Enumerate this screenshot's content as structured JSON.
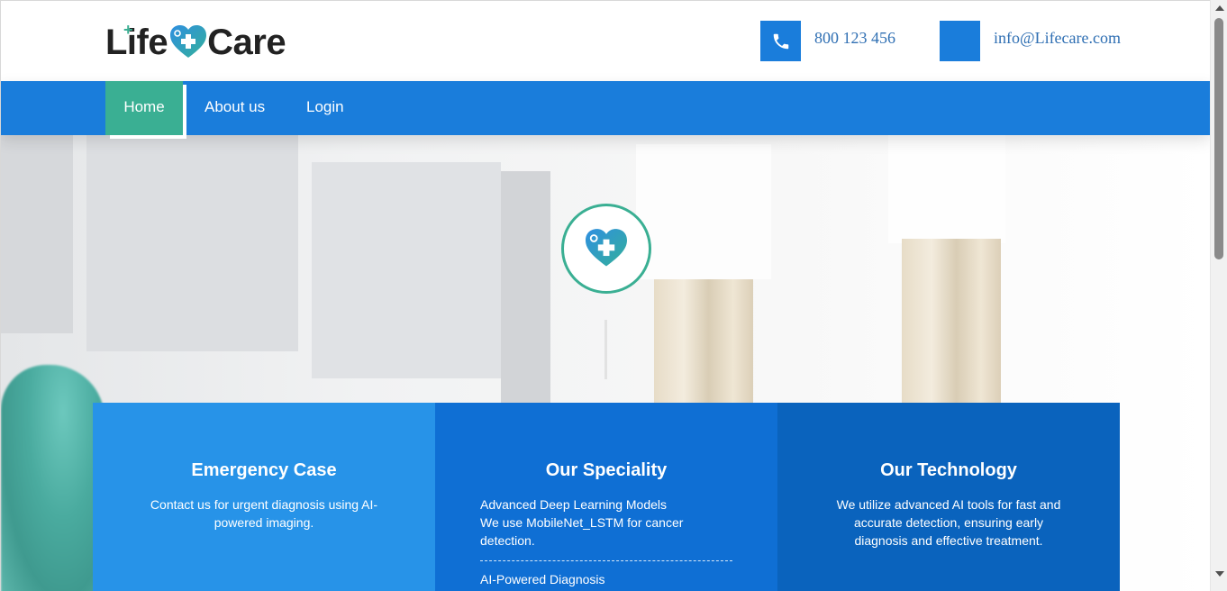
{
  "logo": {
    "left": "Life",
    "right": "Care",
    "plus": "+"
  },
  "contact": {
    "phone": "800 123 456",
    "email": "info@Lifecare.com"
  },
  "nav": {
    "items": [
      {
        "label": "Home"
      },
      {
        "label": "About us"
      },
      {
        "label": "Login"
      }
    ]
  },
  "cards": {
    "emergency": {
      "title": "Emergency Case",
      "text": "Contact us for urgent diagnosis using AI-powered imaging."
    },
    "speciality": {
      "title": "Our Speciality",
      "item1_title": "Advanced Deep Learning Models",
      "item1_text": "We use MobileNet_LSTM for cancer detection.",
      "item2_title": "AI-Powered Diagnosis"
    },
    "technology": {
      "title": "Our Technology",
      "text": "We utilize advanced AI tools for fast and accurate detection, ensuring early diagnosis and effective treatment."
    }
  },
  "colors": {
    "primary": "#1a7ddb",
    "accent": "#3aaf93",
    "card1": "#2793e8",
    "card2": "#0f6fd4",
    "card3": "#0a63bd"
  },
  "icons": {
    "phone": "phone-icon",
    "email": "email-icon",
    "heart": "heart-plus-icon"
  }
}
